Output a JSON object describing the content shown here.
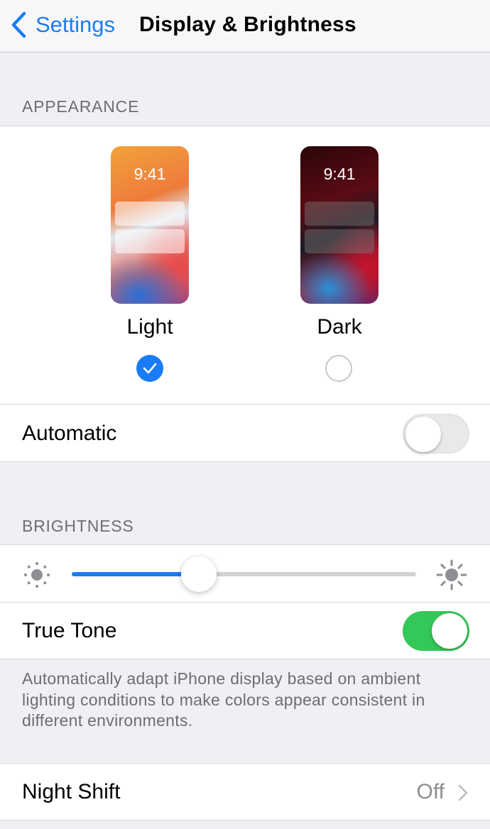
{
  "nav": {
    "back_label": "Settings",
    "title": "Display & Brightness"
  },
  "appearance": {
    "header": "APPEARANCE",
    "light": {
      "time": "9:41",
      "label": "Light",
      "selected": true
    },
    "dark": {
      "time": "9:41",
      "label": "Dark",
      "selected": false
    },
    "automatic": {
      "label": "Automatic",
      "on": false
    }
  },
  "brightness": {
    "header": "BRIGHTNESS",
    "level": 0.37,
    "true_tone": {
      "label": "True Tone",
      "on": true
    },
    "footer": "Automatically adapt iPhone display based on ambient lighting conditions to make colors appear consistent in different environments."
  },
  "night_shift": {
    "label": "Night Shift",
    "value": "Off"
  },
  "colors": {
    "accent": "#1a7cf5",
    "toggle_on": "#34c759",
    "background": "#efeff4"
  },
  "icons": [
    "chevron-left-icon",
    "checkmark-icon",
    "sun-small-icon",
    "sun-large-icon",
    "chevron-right-icon"
  ]
}
